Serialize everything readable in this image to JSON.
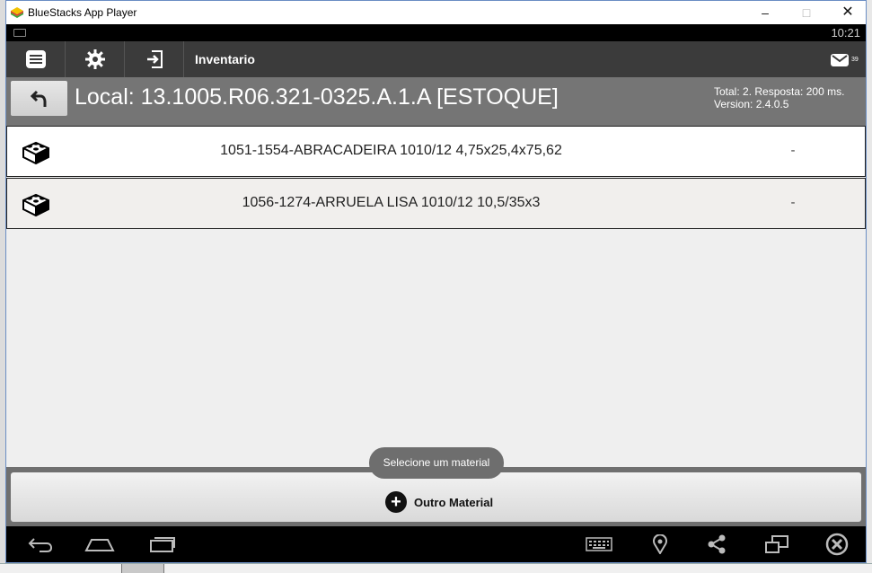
{
  "window": {
    "title": "BlueStacks App Player"
  },
  "statusbar": {
    "time": "10:21"
  },
  "actionbar": {
    "title": "Inventario",
    "mail_count": "39"
  },
  "location": {
    "label": "Local: 13.1005.R06.321-0325.A.1.A [ESTOQUE]",
    "total_line": "Total: 2. Resposta: 200 ms.",
    "version_line": "Version: 2.4.0.5"
  },
  "items": [
    {
      "name": "1051-1554-ABRACADEIRA 1010/12 4,75x25,4x75,62",
      "value": "-"
    },
    {
      "name": "1056-1274-ARRUELA LISA 1010/12 10,5/35x3",
      "value": "-"
    }
  ],
  "toast": {
    "text": "Selecione um material"
  },
  "actions": {
    "outro_material": "Outro Material"
  },
  "icons": {
    "title_logo": "bluestacks-logo-icon",
    "menu": "menu-list-icon",
    "settings": "gear-icon",
    "login": "login-icon",
    "mail": "mail-icon",
    "back": "back-arrow-icon",
    "item": "lego-brick-icon",
    "add": "plus-circle-icon",
    "nav": [
      "back-icon",
      "home-icon",
      "recent-apps-icon",
      "keyboard-icon",
      "location-icon",
      "share-icon",
      "multi-screen-icon",
      "close-app-icon"
    ]
  },
  "colors": {
    "actionbar": "#3b3b3b",
    "location_bar": "#757575",
    "list_bg": "#efefef"
  }
}
